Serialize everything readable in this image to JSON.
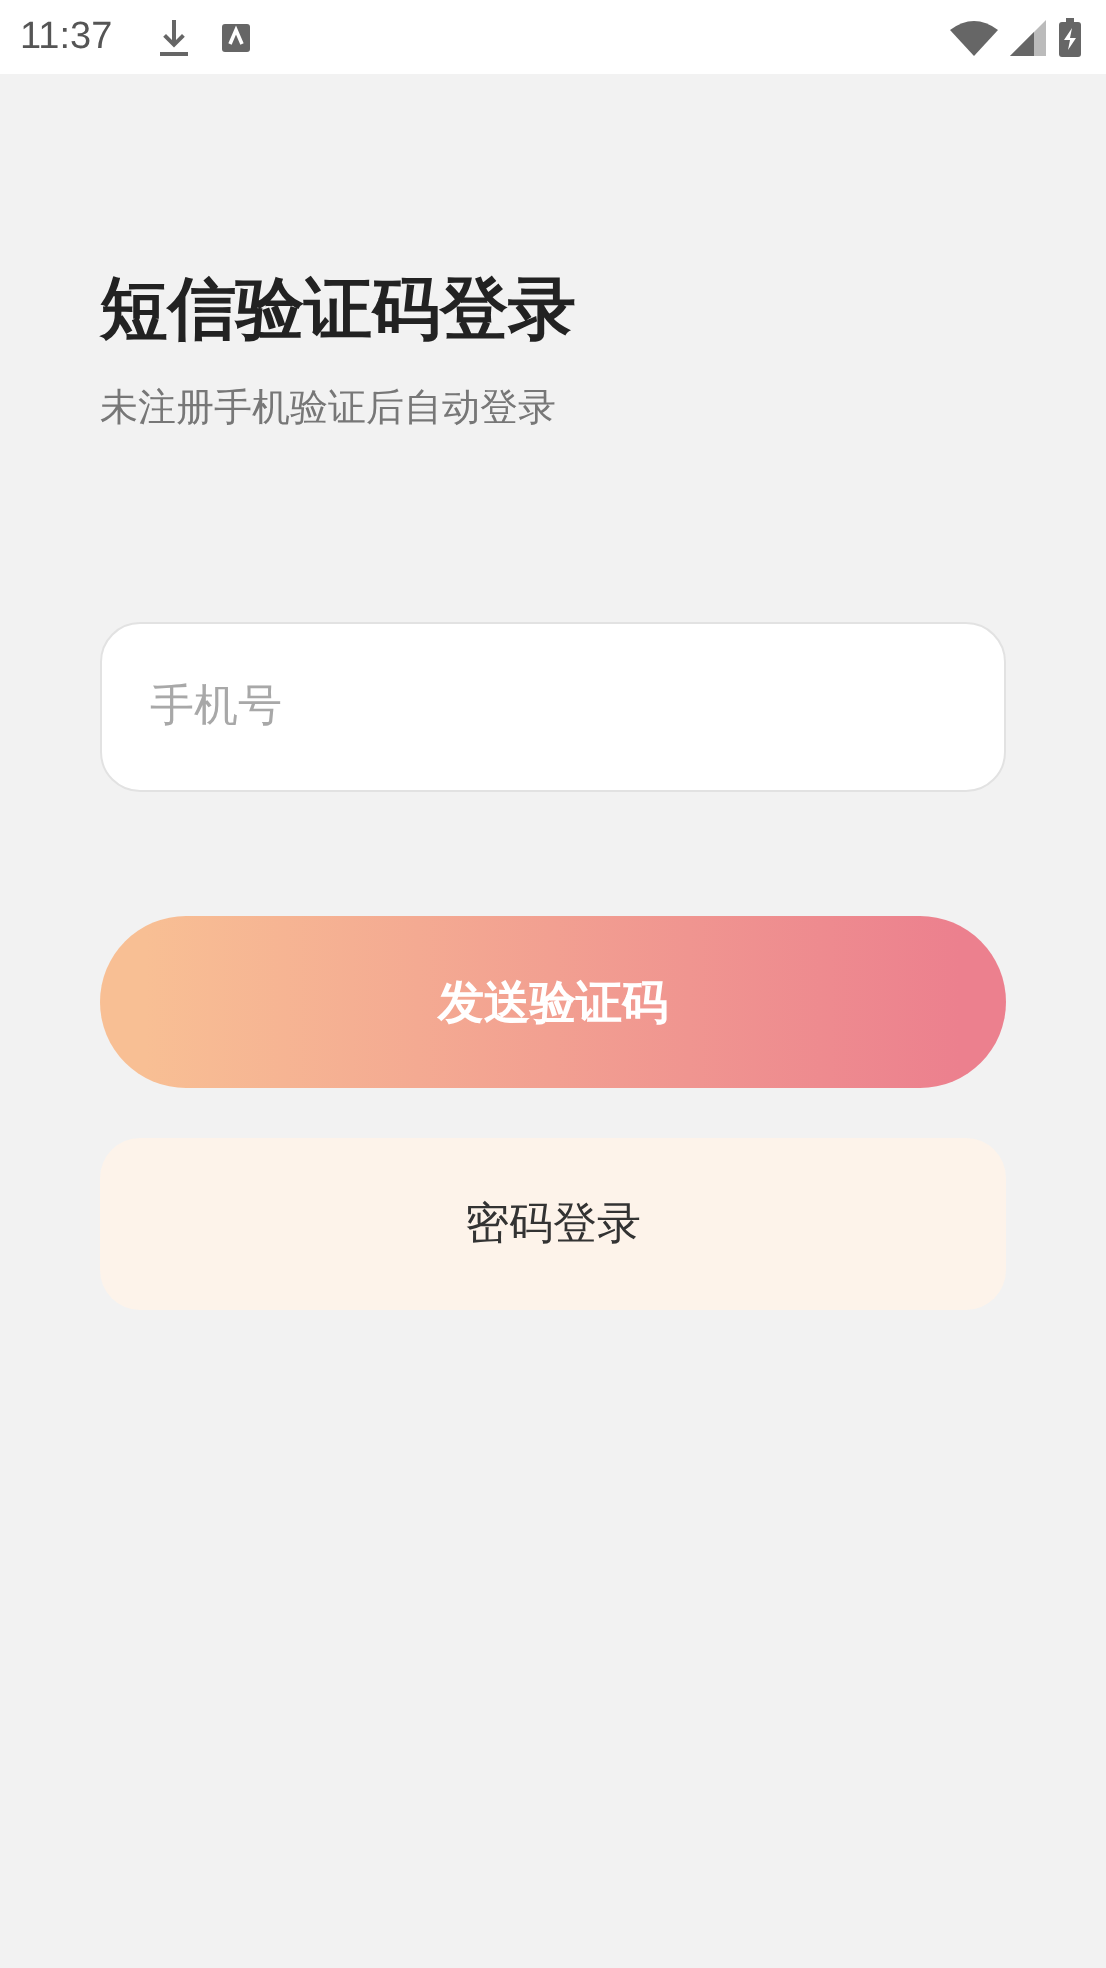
{
  "status_bar": {
    "time": "11:37"
  },
  "title": "短信验证码登录",
  "subtitle": "未注册手机验证后自动登录",
  "phone_field": {
    "placeholder": "手机号"
  },
  "buttons": [
    {
      "label": "发送验证码",
      "kind": "primary"
    },
    {
      "label": "密码登录",
      "kind": "secondary"
    }
  ]
}
